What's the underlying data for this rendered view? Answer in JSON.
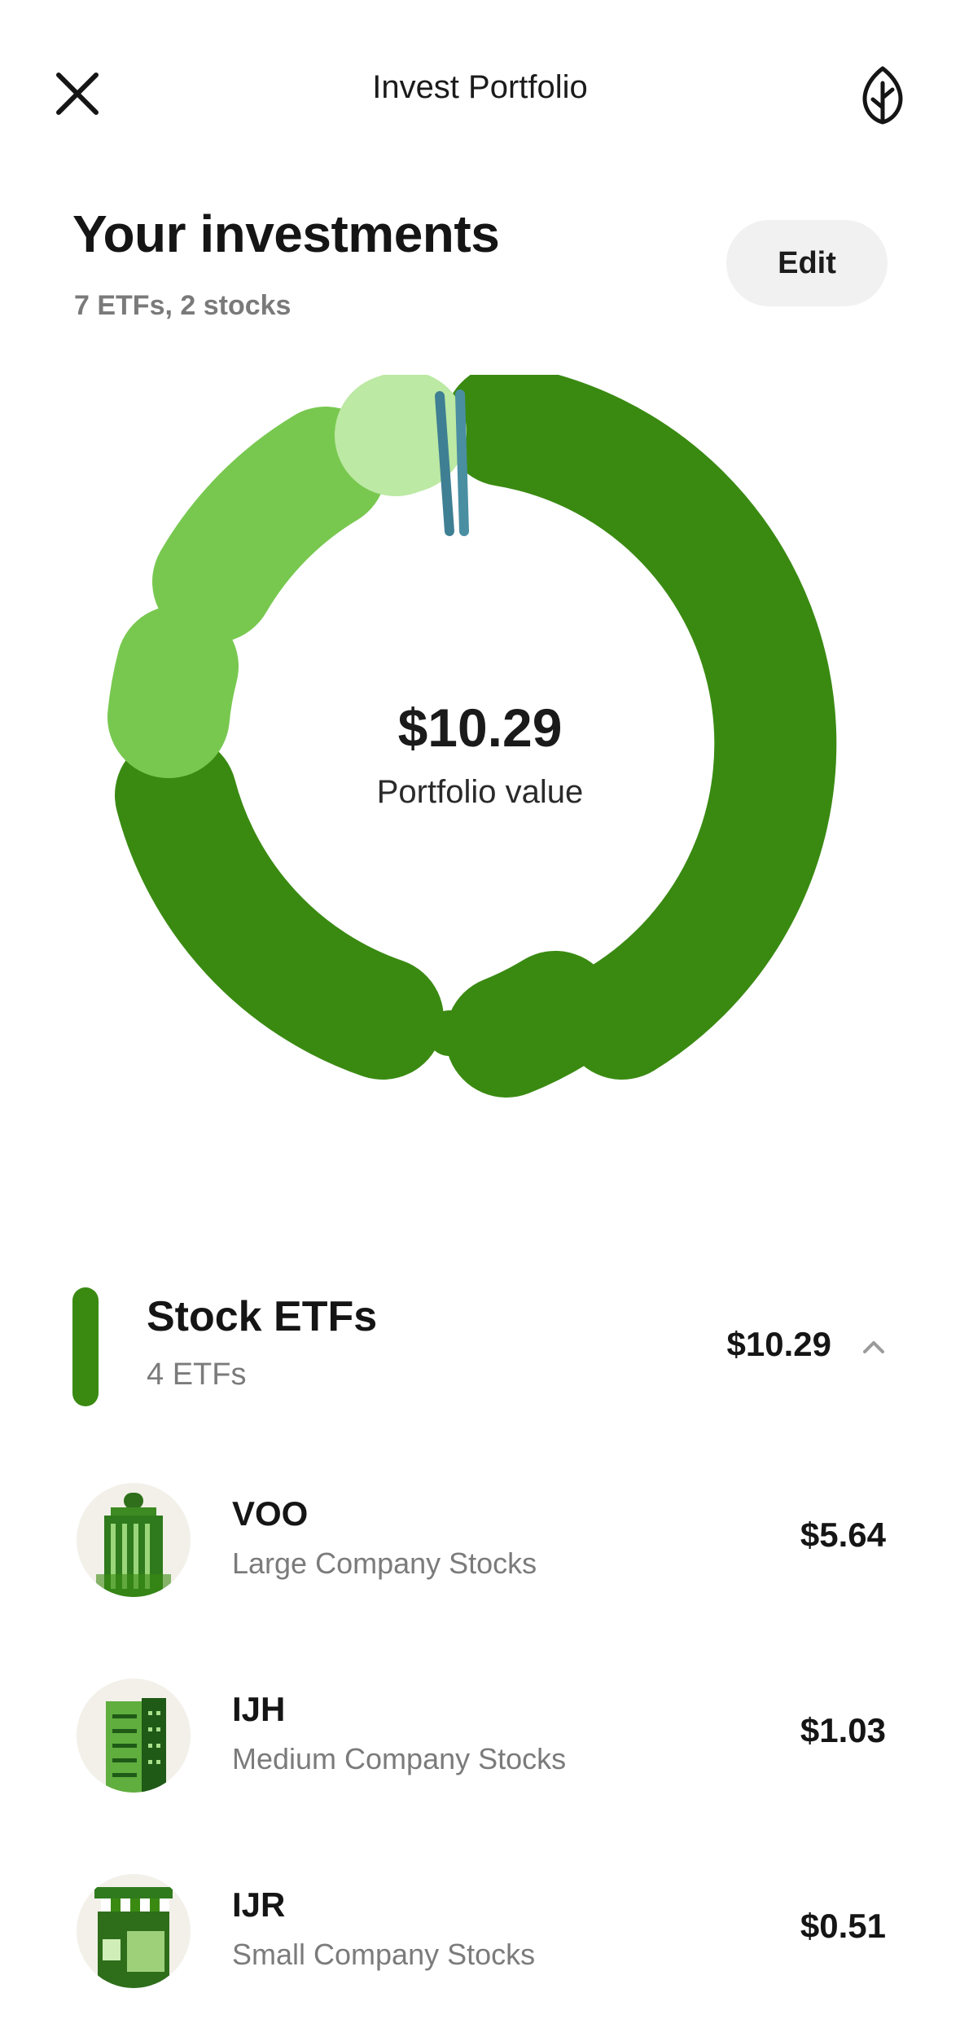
{
  "header": {
    "title": "Invest Portfolio",
    "close_icon": "close-icon",
    "leaf_icon": "leaf-icon"
  },
  "summary": {
    "title": "Your investments",
    "subtitle": "7 ETFs, 2 stocks",
    "edit_label": "Edit"
  },
  "portfolio": {
    "value": "$10.29",
    "label": "Portfolio value"
  },
  "colors": {
    "dark_green": "#3a8a12",
    "mid_green": "#78c850",
    "light_green": "#bce9a3",
    "teal": "#3f7f93",
    "teal2": "#4a8ea2"
  },
  "group": {
    "title": "Stock ETFs",
    "subtitle": "4 ETFs",
    "value": "$10.29",
    "chevron_icon": "chevron-up-icon"
  },
  "holdings": [
    {
      "ticker": "VOO",
      "name": "Large Company Stocks",
      "value": "$5.64",
      "icon": "large-building-icon"
    },
    {
      "ticker": "IJH",
      "name": "Medium Company Stocks",
      "value": "$1.03",
      "icon": "medium-building-icon"
    },
    {
      "ticker": "IJR",
      "name": "Small Company Stocks",
      "value": "$0.51",
      "icon": "storefront-icon"
    }
  ]
}
